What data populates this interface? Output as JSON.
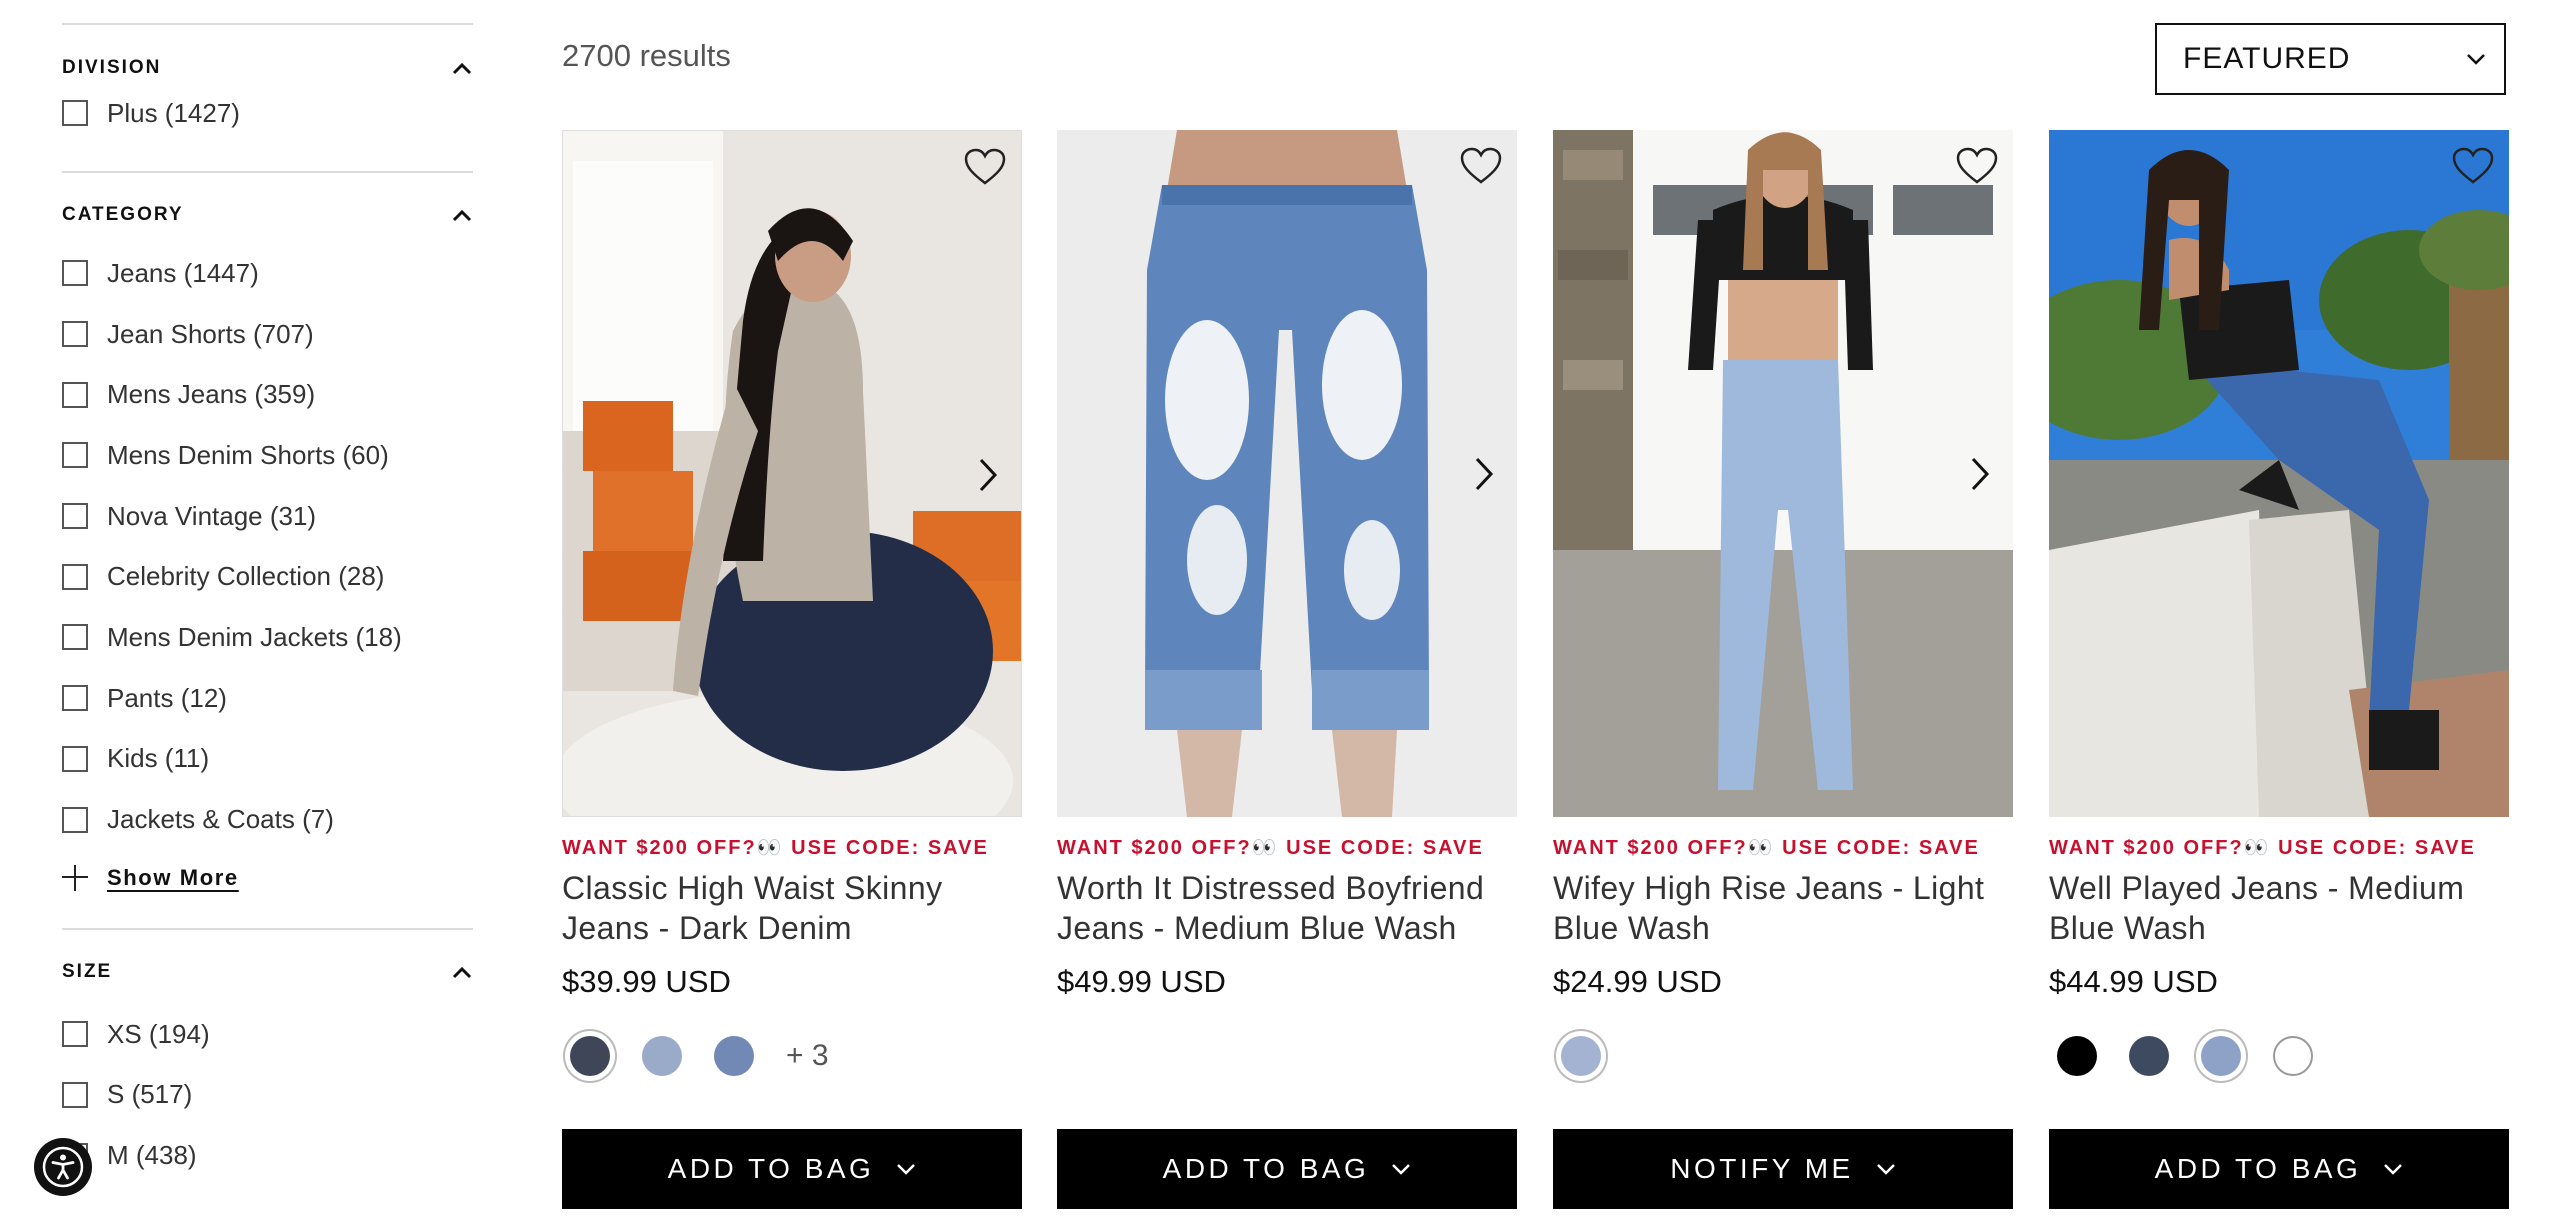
{
  "sidebar": {
    "division": {
      "title": "DIVISION",
      "options": [
        "Plus (1427)"
      ]
    },
    "category": {
      "title": "CATEGORY",
      "options": [
        "Jeans (1447)",
        "Jean Shorts (707)",
        "Mens Jeans (359)",
        "Mens Denim Shorts (60)",
        "Nova Vintage (31)",
        "Celebrity Collection (28)",
        "Mens Denim Jackets (18)",
        "Pants (12)",
        "Kids (11)",
        "Jackets & Coats (7)"
      ],
      "show_more": "Show More"
    },
    "size": {
      "title": "SIZE",
      "options": [
        "XS (194)",
        "S (517)",
        "M (438)"
      ]
    }
  },
  "results_count": "2700 results",
  "sort": {
    "selected": "FEATURED"
  },
  "products": [
    {
      "promo": "WANT $200 OFF?👀 USE CODE: SAVE",
      "name": "Classic High Waist Skinny Jeans - Dark Denim",
      "price": "$39.99 USD",
      "swatches": [
        "#3f4657",
        "#9aaac9",
        "#7189b4"
      ],
      "more_colors": "+ 3",
      "cta": "ADD TO BAG"
    },
    {
      "promo": "WANT $200 OFF?👀 USE CODE: SAVE",
      "name": "Worth It Distressed Boyfriend Jeans - Medium Blue Wash",
      "price": "$49.99 USD",
      "swatches": [],
      "more_colors": "",
      "cta": "ADD TO BAG"
    },
    {
      "promo": "WANT $200 OFF?👀 USE CODE: SAVE",
      "name": "Wifey High Rise Jeans - Light Blue Wash",
      "price": "$24.99 USD",
      "swatches": [
        "#a3b3d1"
      ],
      "more_colors": "",
      "cta": "NOTIFY ME"
    },
    {
      "promo": "WANT $200 OFF?👀 USE CODE: SAVE",
      "name": "Well Played Jeans - Medium Blue Wash",
      "price": "$44.99 USD",
      "swatches": [
        "#000000",
        "#3e4a60",
        "#8ea2c8",
        "#ffffff"
      ],
      "more_colors": "",
      "cta": "ADD TO BAG"
    }
  ],
  "colors": {
    "promo": "#c8102e",
    "cta_bg": "#000000"
  },
  "icons": [
    "chevron-up-icon",
    "chevron-down-icon",
    "heart-icon",
    "chevron-right-icon",
    "plus-icon",
    "accessibility-icon"
  ]
}
